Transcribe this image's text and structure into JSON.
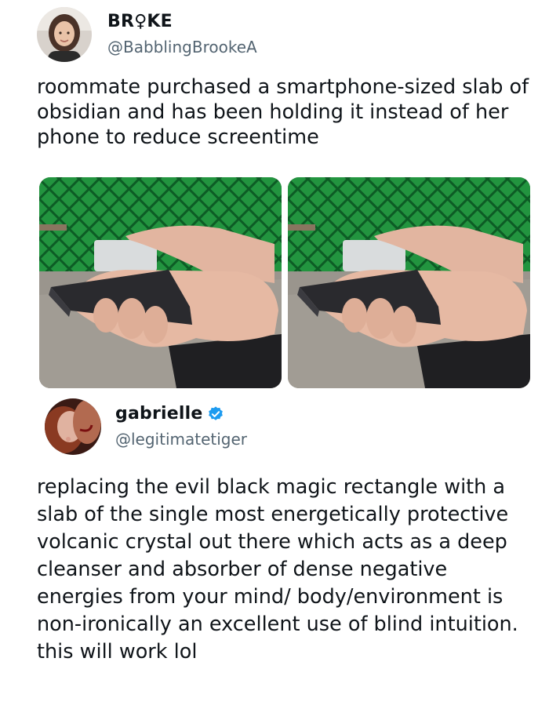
{
  "tweet1": {
    "display_name": "BR♀KE",
    "handle": "@BabblingBrookeA",
    "text": "roommate purchased a smartphone-sized slab of obsidian and has been holding it instead of her phone to reduce screentime"
  },
  "tweet2": {
    "display_name": "gabrielle",
    "handle": "@legitimatetiger",
    "text": "replacing the evil black magic rectangle with a slab of the single most energetically protective volcanic crystal out there which acts as a deep cleanser and absorber of dense negative energies from your mind/ body/environment is non-ironically an excellent use of blind intuition. this will work lol"
  },
  "colors": {
    "text": "#0f1419",
    "secondary": "#536471",
    "verified": "#1d9bf0",
    "fence_green": "#1f8a3e"
  }
}
